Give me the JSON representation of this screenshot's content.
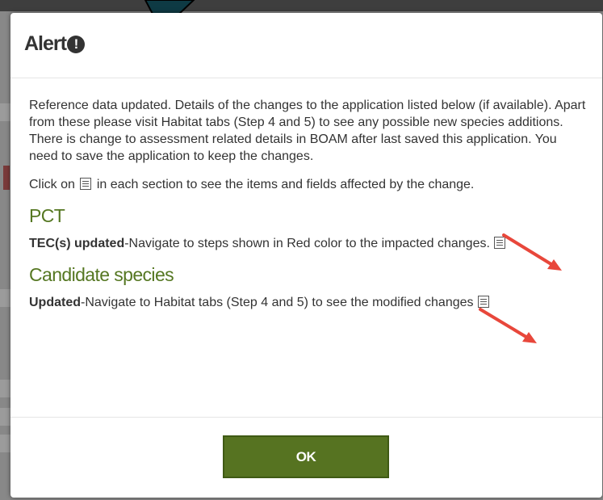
{
  "modal": {
    "title": "Alert",
    "alert_icon_glyph": "!",
    "intro_text": "Reference data updated. Details of the changes to the application listed below (if available). Apart from these please visit Habitat tabs (Step 4 and 5) to see any possible new species additions. There is change to assessment related details in BOAM after last saved this application. You need to save the application to keep the changes.",
    "click_prefix": "Click on",
    "click_suffix": "in each section to see the items and fields affected by the change.",
    "sections": [
      {
        "title": "PCT",
        "bold_label": "TEC(s) updated",
        "text": "-Navigate to steps shown in Red color to the impacted changes."
      },
      {
        "title": "Candidate species",
        "bold_label": "Updated",
        "text": "-Navigate to Habitat tabs (Step 4 and 5) to see the modified changes"
      }
    ],
    "ok_label": "OK"
  },
  "icons": {
    "alert": "exclamation-circle-icon",
    "list": "list-details-icon"
  },
  "colors": {
    "section_title": "#557722",
    "ok_button": "#567321",
    "annotation_arrow": "#e8473b"
  }
}
